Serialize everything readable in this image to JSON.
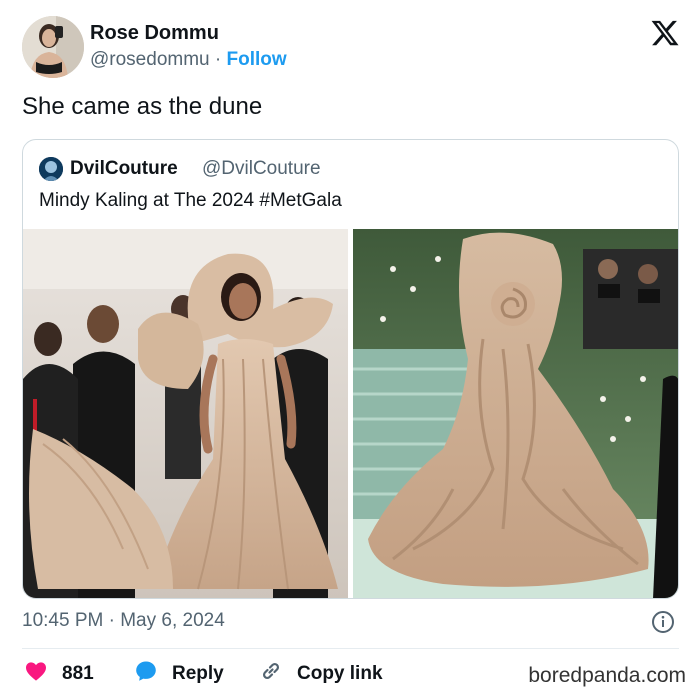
{
  "author": {
    "name": "Rose Dommu",
    "handle": "@rosedommu",
    "separator": "·",
    "follow_label": "Follow"
  },
  "tweet": {
    "text": "She came as the dune"
  },
  "quoted": {
    "name": "DvilCouture",
    "handle": "@DvilCouture",
    "text": "Mindy Kaling at The 2024 #MetGala"
  },
  "meta": {
    "time": "10:45 PM",
    "separator": "·",
    "date": "May 6, 2024"
  },
  "actions": {
    "like_count": "881",
    "reply_label": "Reply",
    "copy_label": "Copy link"
  },
  "watermark": "boredpanda.com",
  "colors": {
    "link": "#1d9bf0",
    "like": "#f91880",
    "reply": "#1d9bf0",
    "secondary_text": "#536471",
    "gown": "#c9a88a"
  },
  "icons": {
    "platform_logo": "x-logo-icon",
    "like": "heart-icon",
    "reply": "speech-bubble-icon",
    "copy": "link-icon",
    "info": "info-icon"
  }
}
